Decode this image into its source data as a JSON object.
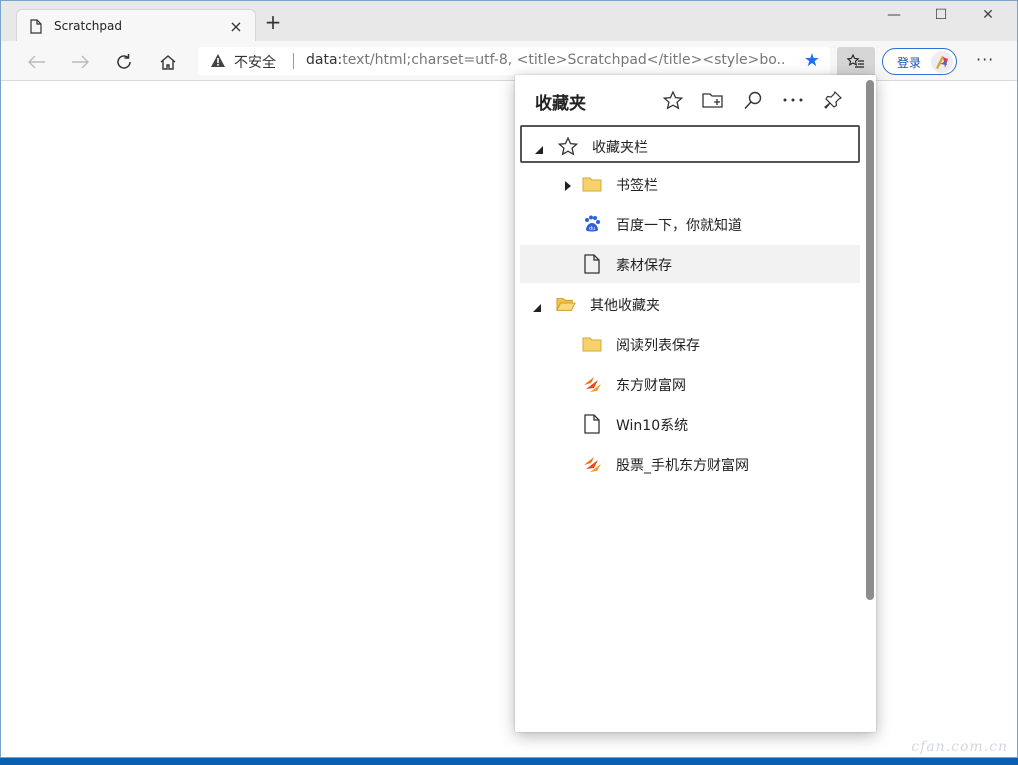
{
  "tab": {
    "title": "Scratchpad",
    "close": "×"
  },
  "newtab": "+",
  "window_controls": {
    "minimize": "—",
    "maximize": "☐",
    "close": "✕"
  },
  "address": {
    "insecure_label": "不安全",
    "url_prefix": "data:",
    "url_rest": "text/html;charset=utf-8, <title>Scratchpad</title><style>bo..."
  },
  "profile": {
    "login_label": "登录"
  },
  "more_label": "···",
  "favorites": {
    "title": "收藏夹",
    "items": [
      {
        "label": "收藏夹栏",
        "icon": "star-outline-icon"
      },
      {
        "label": "书签栏",
        "icon": "folder-icon"
      },
      {
        "label": "百度一下，你就知道",
        "icon": "baidu-paw-icon"
      },
      {
        "label": "素材保存",
        "icon": "page-icon"
      },
      {
        "label": "其他收藏夹",
        "icon": "folder-open-icon"
      },
      {
        "label": "阅读列表保存",
        "icon": "folder-icon"
      },
      {
        "label": "东方财富网",
        "icon": "eastmoney-icon"
      },
      {
        "label": "Win10系统",
        "icon": "page-icon"
      },
      {
        "label": "股票_手机东方财富网",
        "icon": "eastmoney-icon"
      }
    ]
  },
  "watermark": "cfan.com.cn"
}
